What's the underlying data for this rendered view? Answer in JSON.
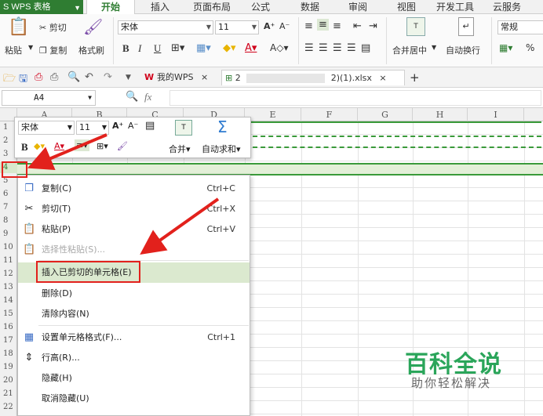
{
  "app": {
    "title": "WPS 表格"
  },
  "menu_tabs": [
    "开始",
    "插入",
    "页面布局",
    "公式",
    "数据",
    "审阅",
    "视图",
    "开发工具",
    "云服务"
  ],
  "ribbon": {
    "paste": "粘贴",
    "cut": "剪切",
    "copy": "复制",
    "format_painter": "格式刷",
    "font_name": "宋体",
    "font_size": "11",
    "merge_center": "合并居中",
    "auto_wrap": "自动换行",
    "number_format": "常规",
    "percent": "%"
  },
  "quickbar": {
    "wps_tab": "我的WPS",
    "file_tab_prefix": "2",
    "file_tab_suffix": "2)(1).xlsx",
    "close": "×",
    "new_tab": "+"
  },
  "formula_bar": {
    "cell_ref": "A4",
    "fx": "fx"
  },
  "columns": [
    "A",
    "B",
    "C",
    "D",
    "E",
    "F",
    "G",
    "H",
    "I"
  ],
  "rows": [
    "1",
    "2",
    "3",
    "4",
    "5",
    "6",
    "7",
    "8",
    "9",
    "10",
    "11",
    "12",
    "13",
    "14",
    "15",
    "16",
    "17",
    "18",
    "19",
    "20",
    "21",
    "22"
  ],
  "mini_toolbar": {
    "font_name": "宋体",
    "font_size": "11",
    "merge": "合并",
    "autosum": "自动求和",
    "bold": "B",
    "font_color": "A"
  },
  "context_menu": [
    {
      "label": "复制(C)",
      "shortcut": "Ctrl+C",
      "icon": "copy-icon",
      "enabled": true
    },
    {
      "label": "剪切(T)",
      "shortcut": "Ctrl+X",
      "icon": "cut-icon",
      "enabled": true
    },
    {
      "label": "粘贴(P)",
      "shortcut": "Ctrl+V",
      "icon": "paste-icon",
      "enabled": true
    },
    {
      "label": "选择性粘贴(S)...",
      "shortcut": "",
      "icon": "paste-special-icon",
      "enabled": false
    },
    {
      "label": "插入已剪切的单元格(E)",
      "shortcut": "",
      "icon": "",
      "enabled": true,
      "highlighted": true
    },
    {
      "label": "删除(D)",
      "shortcut": "",
      "icon": "",
      "enabled": true
    },
    {
      "label": "清除内容(N)",
      "shortcut": "",
      "icon": "",
      "enabled": true
    },
    {
      "label": "设置单元格格式(F)...",
      "shortcut": "Ctrl+1",
      "icon": "format-cells-icon",
      "enabled": true
    },
    {
      "label": "行高(R)...",
      "shortcut": "",
      "icon": "row-height-icon",
      "enabled": true
    },
    {
      "label": "隐藏(H)",
      "shortcut": "",
      "icon": "",
      "enabled": true
    },
    {
      "label": "取消隐藏(U)",
      "shortcut": "",
      "icon": "",
      "enabled": true
    }
  ],
  "watermark": {
    "title": "百科全说",
    "subtitle": "助你轻松解决"
  },
  "colors": {
    "accent": "#2f7d32",
    "highlight": "#dbe9cf",
    "annotation_red": "#e2211c",
    "watermark_green": "#2aa55a"
  }
}
